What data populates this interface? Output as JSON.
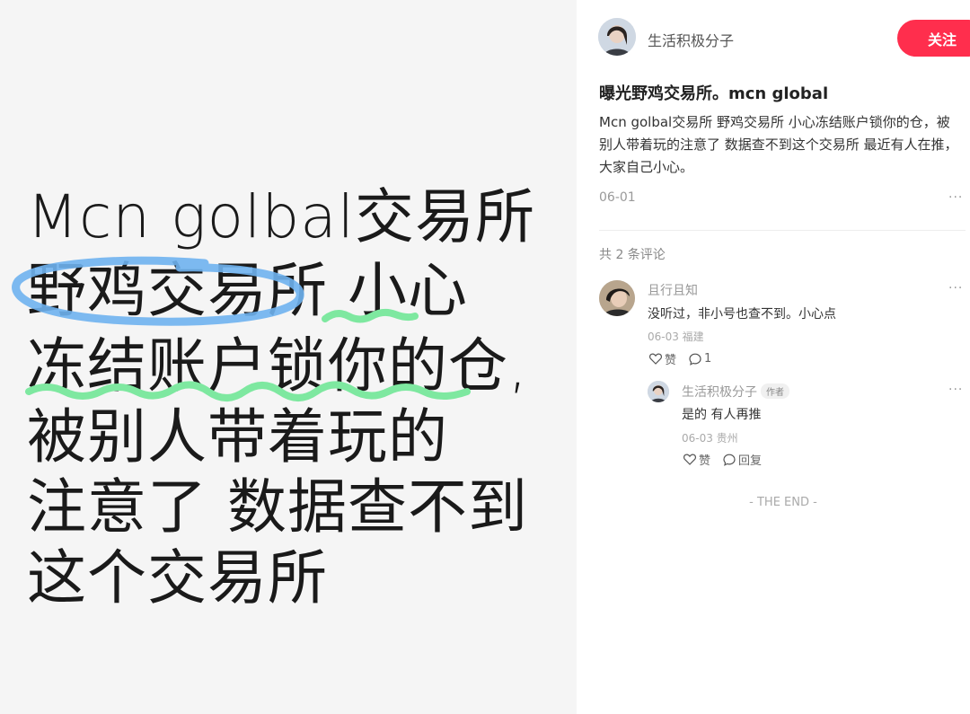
{
  "image_text": {
    "line1": "Mcn golbal交易所",
    "line2": "野鸡交易所  小心",
    "line3": "冻结账户锁你的仓,",
    "line4": "被别人带着玩的",
    "line5": "注意了  数据查不到",
    "line6": "这个交易所"
  },
  "author": {
    "name": "生活积极分子",
    "follow_label": "关注"
  },
  "note": {
    "title": "曝光野鸡交易所。mcn global",
    "description": "Mcn golbal交易所 野鸡交易所 小心冻结账户锁你的仓，被别人带着玩的注意了  数据查不到这个交易所  最近有人在推，大家自己小心。",
    "date": "06-01",
    "more": "···"
  },
  "comments_header": "共 2 条评论",
  "comments": [
    {
      "name": "且行且知",
      "text": "没听过，非小号也查不到。小心点",
      "meta": "06-03 福建",
      "like_label": "赞",
      "reply_count": "1",
      "more": "···"
    },
    {
      "name": "生活积极分子",
      "tag": "作者",
      "text": "是的 有人再推",
      "meta": "06-03 贵州",
      "like_label": "赞",
      "reply_label": "回复",
      "more": "···"
    }
  ],
  "footer": "- THE END -",
  "colors": {
    "accent": "#ff2e4d",
    "highlight_blue": "#6fb3f0",
    "highlight_green": "#7ee8a0"
  },
  "icons": {
    "like": "heart-outline-icon",
    "comment": "speech-bubble-icon",
    "more": "ellipsis-icon"
  }
}
